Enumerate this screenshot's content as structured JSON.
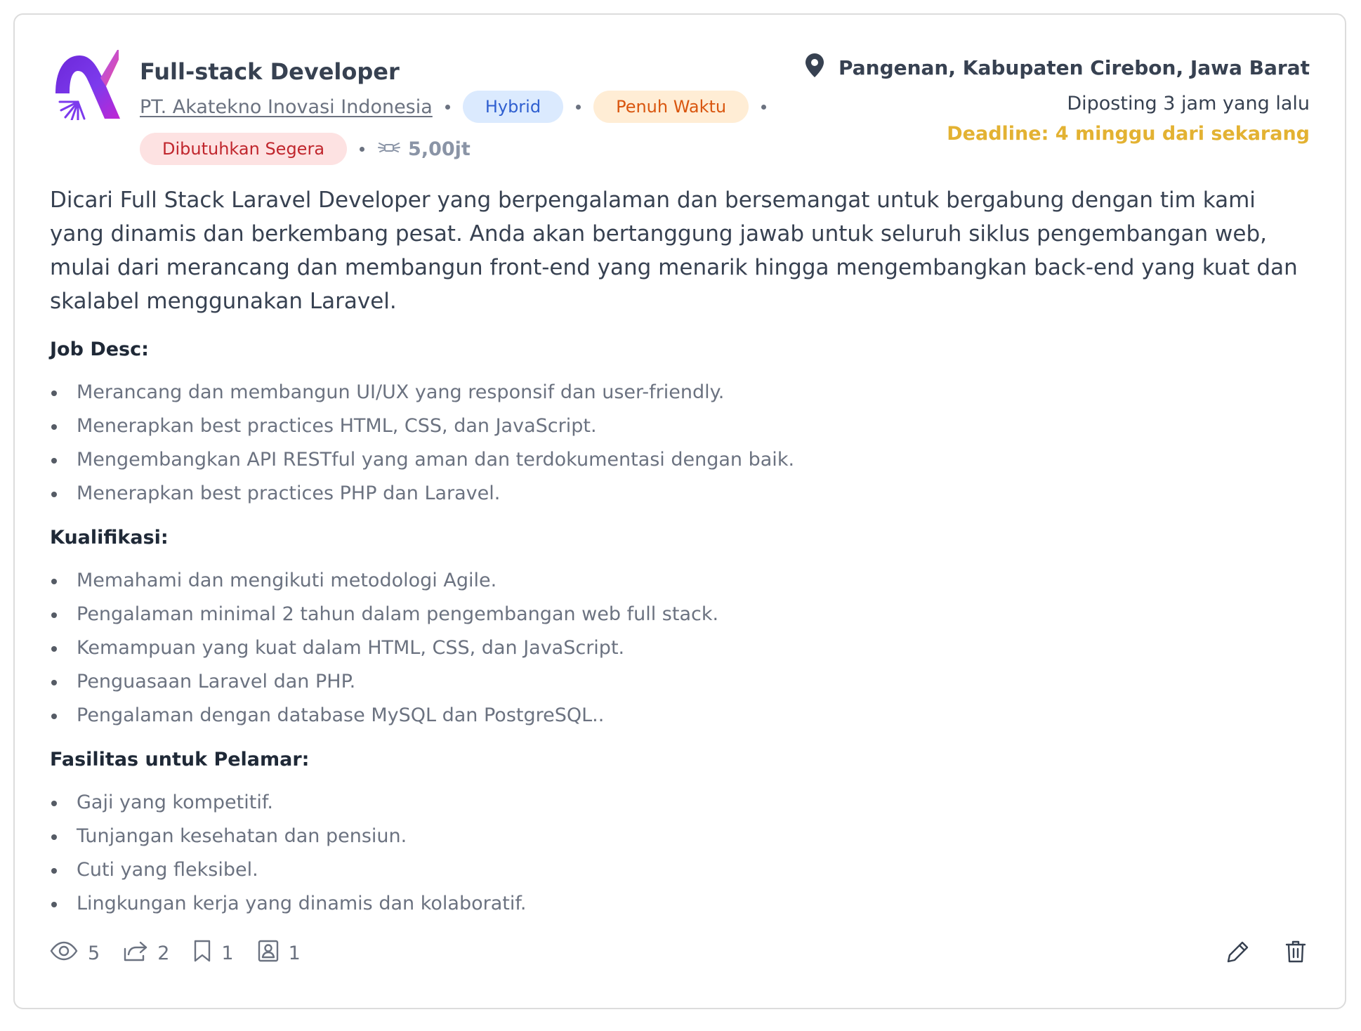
{
  "job": {
    "title": "Full-stack Developer",
    "company": "PT. Akatekno Inovasi Indonesia",
    "badges": {
      "work_mode": "Hybrid",
      "employment_type": "Penuh Waktu",
      "urgency": "Dibutuhkan Segera"
    },
    "salary": "5,00jt",
    "location": "Pangenan, Kabupaten Cirebon, Jawa Barat",
    "posted": "Diposting 3 jam yang lalu",
    "deadline": "Deadline: 4 minggu dari sekarang",
    "description": "Dicari Full Stack Laravel Developer yang berpengalaman dan bersemangat untuk bergabung dengan tim kami yang dinamis dan berkembang pesat. Anda akan bertanggung jawab untuk seluruh siklus pengembangan web, mulai dari merancang dan membangun front-end yang menarik hingga mengembangkan back-end yang kuat dan skalabel menggunakan Laravel."
  },
  "sections": {
    "job_desc": {
      "heading": "Job Desc:",
      "items": [
        "Merancang dan membangun UI/UX yang responsif dan user-friendly.",
        "Menerapkan best practices HTML, CSS, dan JavaScript.",
        "Mengembangkan API RESTful yang aman dan terdokumentasi dengan baik.",
        "Menerapkan best practices PHP dan Laravel."
      ]
    },
    "qualifications": {
      "heading": "Kualifikasi:",
      "items": [
        "Memahami dan mengikuti metodologi Agile.",
        "Pengalaman minimal 2 tahun dalam pengembangan web full stack.",
        "Kemampuan yang kuat dalam HTML, CSS, dan JavaScript.",
        "Penguasaan Laravel dan PHP.",
        "Pengalaman dengan database MySQL dan PostgreSQL.."
      ]
    },
    "benefits": {
      "heading": "Fasilitas untuk Pelamar:",
      "items": [
        "Gaji yang kompetitif.",
        "Tunjangan kesehatan dan pensiun.",
        "Cuti yang fleksibel.",
        "Lingkungan kerja yang dinamis dan kolaboratif."
      ]
    }
  },
  "stats": {
    "views": "5",
    "shares": "2",
    "bookmarks": "1",
    "applicants": "1"
  },
  "colors": {
    "brand_gradient_start": "#7c3aed",
    "brand_gradient_end": "#ec4899",
    "deadline": "#e3b232",
    "badge_blue_bg": "#dbeafe",
    "badge_orange_bg": "#ffedd5",
    "badge_red_bg": "#fde2e2"
  },
  "icons": {
    "location": "map-pin-icon",
    "salary": "money-wings-icon",
    "views": "eye-icon",
    "shares": "share-icon",
    "bookmarks": "bookmark-icon",
    "applicants": "applicant-icon",
    "edit": "pencil-icon",
    "delete": "trash-icon"
  }
}
